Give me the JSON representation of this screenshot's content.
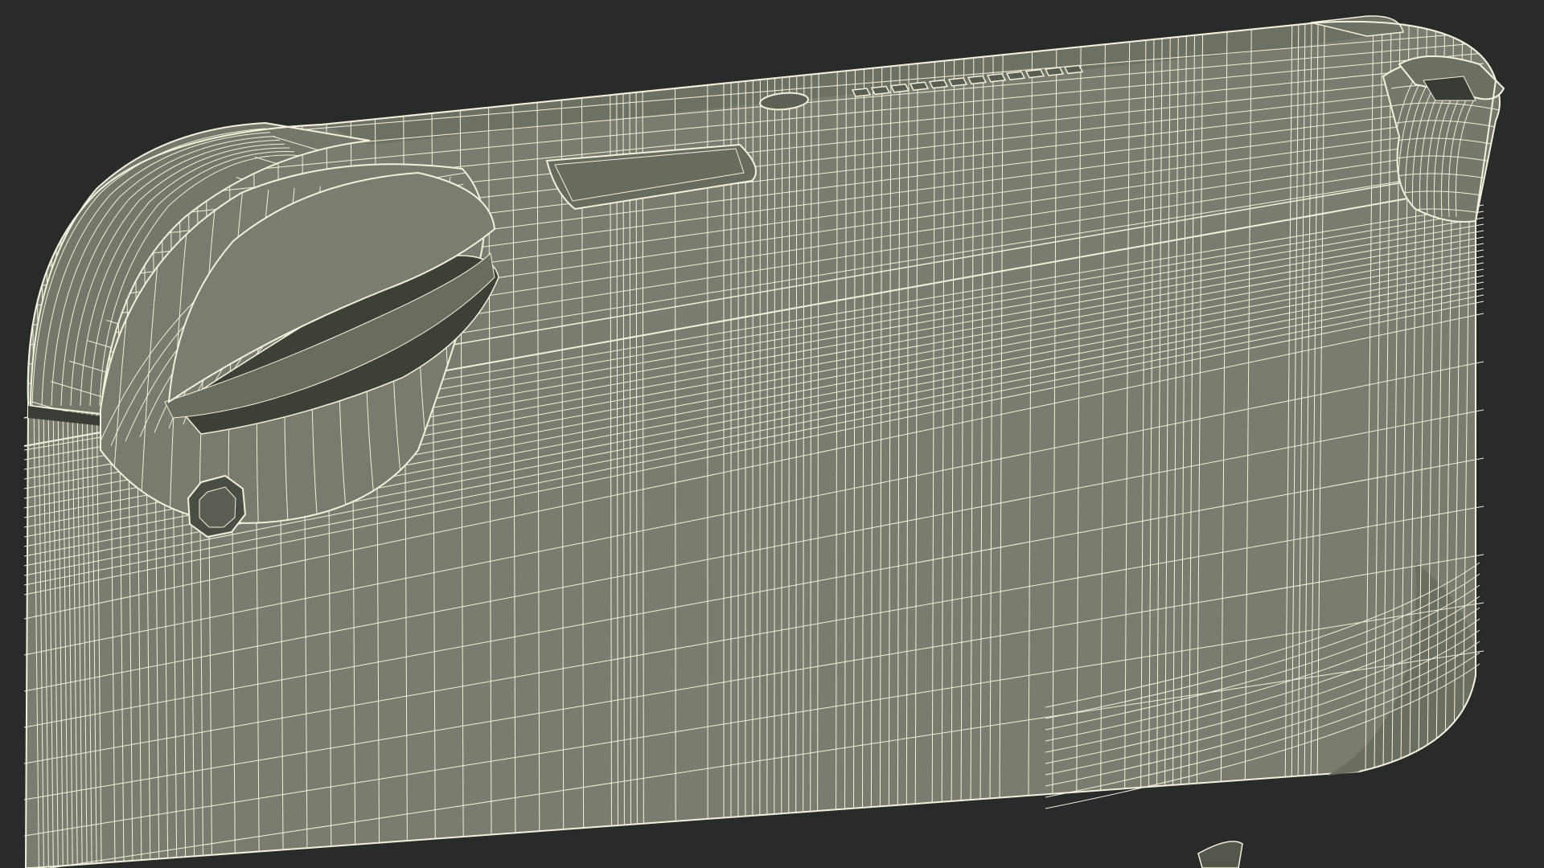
{
  "scene": {
    "background_color": "#2a2a2a",
    "surface_color": "#7b7c6f",
    "surface_dark_color": "#626357",
    "surface_shadow_color": "#55564c",
    "wire_color": "#f2f0df",
    "wire_soft_color": "#d9d7c6"
  },
  "model": {
    "subject": "handheld-console-back-wireframe",
    "render_style": "wireframe-over-shaded"
  }
}
